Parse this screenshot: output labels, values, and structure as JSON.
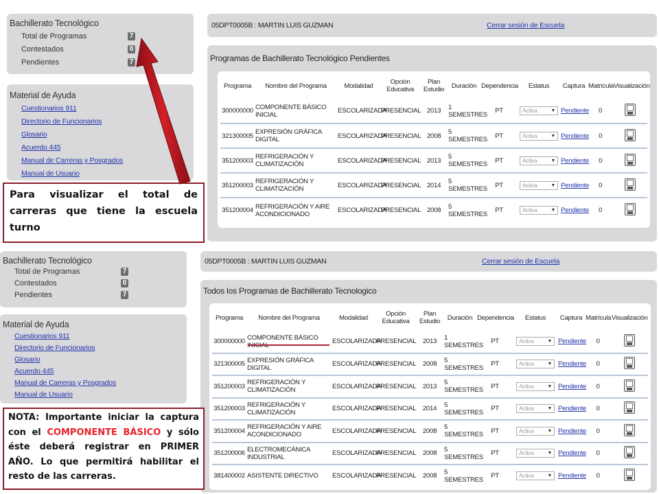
{
  "sidebar_stats": {
    "title": "Bachillerato Tecnológico",
    "items": [
      {
        "label": "Total de Programas",
        "count": "7"
      },
      {
        "label": "Contestados",
        "count": "0"
      },
      {
        "label": "Pendientes",
        "count": "7"
      }
    ]
  },
  "sidebar_help": {
    "title": "Material de Ayuda",
    "links": [
      "Cuestionarios 911",
      "Directorio de Funcionarios",
      "Glosario",
      "Acuerdo 445",
      "Manual de Carreras y Posgrados",
      "Manual de Usuario"
    ]
  },
  "header": {
    "school": "05DPT0005B : MARTIN LUIS GUZMAN",
    "logout": "Cerrar sesión de Escuela"
  },
  "table_columns": [
    "Programa",
    "Nombre del Programa",
    "Modalidad",
    "Opción Educativa",
    "Plan Estudio",
    "Duración",
    "Dependencia",
    "Estatus",
    "Captura",
    "Matrícula",
    "Visualización"
  ],
  "top_panel": {
    "title": "Programas de Bachillerato Tecnológico Pendientes",
    "rows": [
      {
        "programa": "300000000",
        "nombre": "COMPONENTE BÁSICO INICIAL",
        "modalidad": "ESCOLARIZADA",
        "opcion": "PRESENCIAL",
        "plan": "2013",
        "duracion_num": "1",
        "duracion_unit": "SEMESTRES",
        "dependencia": "PT",
        "estatus": "Activa",
        "captura": "Pendiente",
        "matricula": "0"
      },
      {
        "programa": "321300005",
        "nombre": "EXPRESIÓN GRÁFICA DIGITAL",
        "modalidad": "ESCOLARIZADA",
        "opcion": "PRESENCIAL",
        "plan": "2008",
        "duracion_num": "5",
        "duracion_unit": "SEMESTRES",
        "dependencia": "PT",
        "estatus": "Activa",
        "captura": "Pendiente",
        "matricula": "0"
      },
      {
        "programa": "351200003",
        "nombre": "REFRIGERACIÓN Y CLIMATIZACIÓN",
        "modalidad": "ESCOLARIZADA",
        "opcion": "PRESENCIAL",
        "plan": "2013",
        "duracion_num": "5",
        "duracion_unit": "SEMESTRES",
        "dependencia": "PT",
        "estatus": "Activa",
        "captura": "Pendiente",
        "matricula": "0"
      },
      {
        "programa": "351200003",
        "nombre": "REFRIGERACIÓN Y CLIMATIZACIÓN",
        "modalidad": "ESCOLARIZADA",
        "opcion": "PRESENCIAL",
        "plan": "2014",
        "duracion_num": "5",
        "duracion_unit": "SEMESTRES",
        "dependencia": "PT",
        "estatus": "Activa",
        "captura": "Pendiente",
        "matricula": "0"
      },
      {
        "programa": "351200004",
        "nombre": "REFRIGERACIÓN Y AIRE ACONDICIONADO",
        "modalidad": "ESCOLARIZADA",
        "opcion": "PRESENCIAL",
        "plan": "2008",
        "duracion_num": "5",
        "duracion_unit": "SEMESTRES",
        "dependencia": "PT",
        "estatus": "Activa",
        "captura": "Pendiente",
        "matricula": "0"
      }
    ]
  },
  "bottom_panel": {
    "title": "Todos los Programas de Bachillerato Tecnologico",
    "rows": [
      {
        "programa": "300000000",
        "nombre": "COMPONENTE BÁSICO INICIAL",
        "modalidad": "ESCOLARIZADA",
        "opcion": "PRESENCIAL",
        "plan": "2013",
        "duracion_num": "1",
        "duracion_unit": "SEMESTRES",
        "dependencia": "PT",
        "estatus": "Activa",
        "captura": "Pendiente",
        "matricula": "0"
      },
      {
        "programa": "321300005",
        "nombre": "EXPRESIÓN GRÁFICA DIGITAL",
        "modalidad": "ESCOLARIZADA",
        "opcion": "PRESENCIAL",
        "plan": "2008",
        "duracion_num": "5",
        "duracion_unit": "SEMESTRES",
        "dependencia": "PT",
        "estatus": "Activa",
        "captura": "Pendiente",
        "matricula": "0"
      },
      {
        "programa": "351200003",
        "nombre": "REFRIGERACIÓN Y CLIMATIZACIÓN",
        "modalidad": "ESCOLARIZADA",
        "opcion": "PRESENCIAL",
        "plan": "2013",
        "duracion_num": "5",
        "duracion_unit": "SEMESTRES",
        "dependencia": "PT",
        "estatus": "Activa",
        "captura": "Pendiente",
        "matricula": "0"
      },
      {
        "programa": "351200003",
        "nombre": "REFRIGERACIÓN Y CLIMATIZACIÓN",
        "modalidad": "ESCOLARIZADA",
        "opcion": "PRESENCIAL",
        "plan": "2014",
        "duracion_num": "5",
        "duracion_unit": "SEMESTRES",
        "dependencia": "PT",
        "estatus": "Activa",
        "captura": "Pendiente",
        "matricula": "0"
      },
      {
        "programa": "351200004",
        "nombre": "REFRIGERACIÓN Y AIRE ACONDICIONADO",
        "modalidad": "ESCOLARIZADA",
        "opcion": "PRESENCIAL",
        "plan": "2008",
        "duracion_num": "5",
        "duracion_unit": "SEMESTRES",
        "dependencia": "PT",
        "estatus": "Activa",
        "captura": "Pendiente",
        "matricula": "0"
      },
      {
        "programa": "351200006",
        "nombre": "ELECTROMECÁNICA INDUSTRIAL",
        "modalidad": "ESCOLARIZADA",
        "opcion": "PRESENCIAL",
        "plan": "2008",
        "duracion_num": "5",
        "duracion_unit": "SEMESTRES",
        "dependencia": "PT",
        "estatus": "Activa",
        "captura": "Pendiente",
        "matricula": "0"
      },
      {
        "programa": "381400002",
        "nombre": "ASISTENTE DIRECTIVO",
        "modalidad": "ESCOLARIZADA",
        "opcion": "PRESENCIAL",
        "plan": "2008",
        "duracion_num": "5",
        "duracion_unit": "SEMESTRES",
        "dependencia": "PT",
        "estatus": "Activa",
        "captura": "Pendiente",
        "matricula": "0"
      }
    ]
  },
  "callout_top": {
    "text": "Para visualizar el total de carreras que tiene la escuela turno"
  },
  "callout_bottom": {
    "prefix": "NOTA: Importante iniciar la captura con el",
    "highlight": "COMPONENTE BÁSICO",
    "suffix": "y sólo éste deberá registrar en PRIMER AÑO. Lo que permitirá habilitar el resto de las carreras."
  },
  "colors": {
    "panel_gray": "#d9d9dc",
    "link_blue": "#2233aa",
    "callout_border": "#8b1c2c",
    "arrow_red": "#c0161e",
    "highlight_red": "#e8202a"
  }
}
